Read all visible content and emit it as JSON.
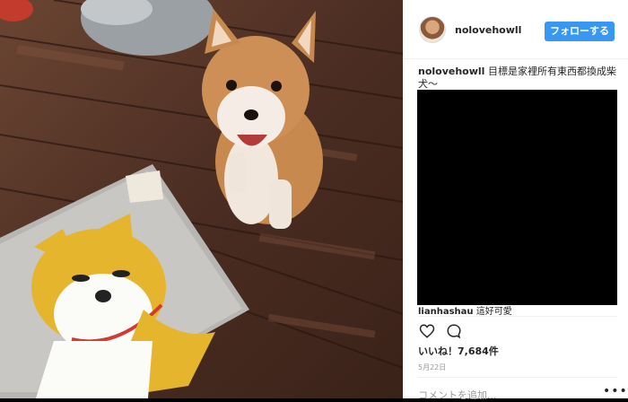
{
  "post": {
    "username": "nolovehowll",
    "follow_label": "フォローする",
    "caption_user": "nolovehowll",
    "caption_text": "目標是家裡所有東西都換成柴犬〜",
    "comment_user": "lianhashau",
    "comment_text": "這好可愛",
    "likes": "いいね！7,684件",
    "date": "5月22日",
    "add_comment_placeholder": "コメントを追加...",
    "more_label": "•••"
  },
  "icons": {
    "like": "heart-icon",
    "comment": "comment-icon",
    "avatar": "avatar"
  },
  "colors": {
    "follow_button": "#3897f0",
    "redaction": "#000000"
  }
}
